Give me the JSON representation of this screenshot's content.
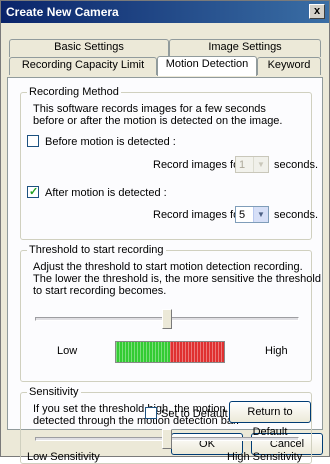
{
  "window": {
    "title": "Create New Camera",
    "close_glyph": "x"
  },
  "tabs": {
    "row_back": [
      "Basic Settings",
      "Image Settings"
    ],
    "row_front": [
      "Recording Capacity Limit",
      "Motion Detection",
      "Keyword"
    ],
    "active": "Motion Detection"
  },
  "recording_method": {
    "title": "Recording Method",
    "desc_line1": "This software records images for a few seconds",
    "desc_line2": "before or after the motion is detected on the image.",
    "before": {
      "label": "Before motion is detected :",
      "checked": false,
      "record_label": "Record images for",
      "value": "1",
      "unit": "seconds."
    },
    "after": {
      "label": "After motion is detected :",
      "checked": true,
      "record_label": "Record images for",
      "value": "5",
      "unit": "seconds."
    }
  },
  "threshold": {
    "title": "Threshold to start recording",
    "desc_line1": "Adjust the threshold to start motion detection recording.",
    "desc_line2": "The lower the threshold is, the more sensitive the threshold",
    "desc_line3": "to start recording becomes.",
    "low_label": "Low",
    "high_label": "High",
    "level": 0.5,
    "bar_colors": {
      "green": "#33cc33",
      "red": "#e03030"
    }
  },
  "sensitivity": {
    "title": "Sensitivity",
    "desc_line1": "If you set the threshold high, the motion is sensitively",
    "desc_line2": "detected through the motion detection bar.",
    "low_label": "Low Sensitivity",
    "high_label": "High Sensitivity",
    "level": 0.5
  },
  "defaults": {
    "set_label": "Set to Default",
    "set_checked": false,
    "return_label": "Return to Default"
  },
  "footer": {
    "ok_label": "OK",
    "cancel_label": "Cancel"
  }
}
